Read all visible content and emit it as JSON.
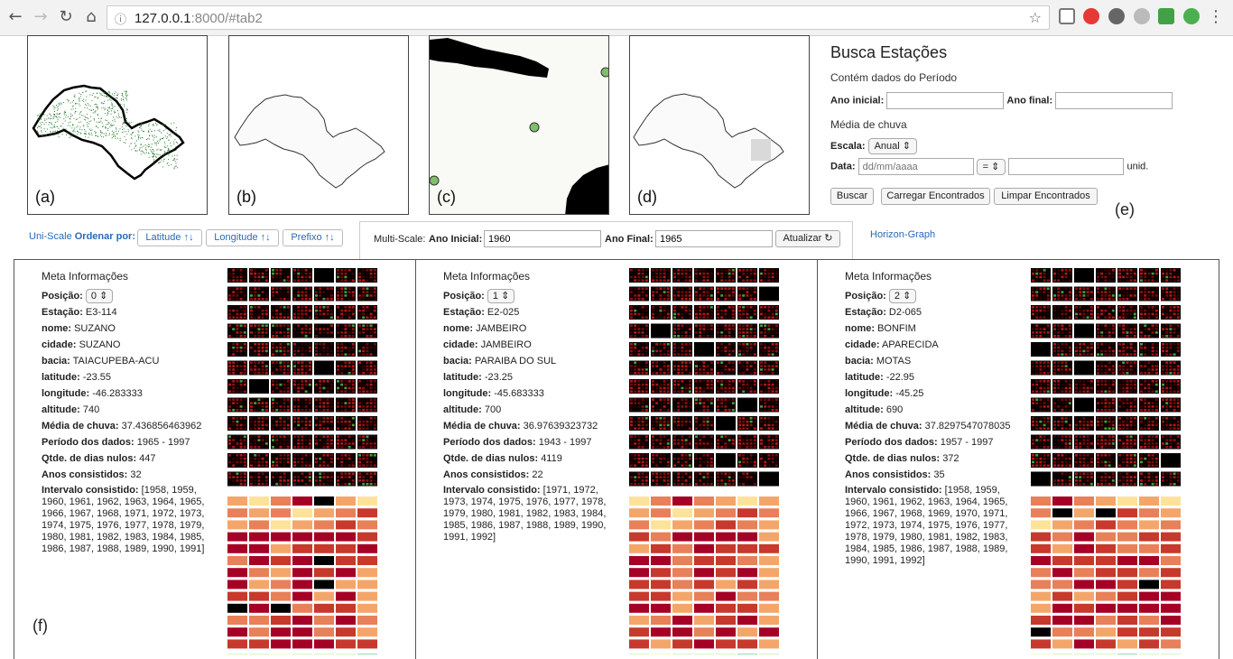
{
  "browser": {
    "url_host": "127.0.0.1",
    "url_rest": ":8000/#tab2"
  },
  "maps": [
    {
      "label": "(a)"
    },
    {
      "label": "(b)"
    },
    {
      "label": "(c)"
    },
    {
      "label": "(d)"
    }
  ],
  "busca": {
    "title": "Busca Estações",
    "periodo_label": "Contém dados do Período",
    "ano_inicial_label": "Ano inicial:",
    "ano_final_label": "Ano final:",
    "media_label": "Média de chuva",
    "escala_label": "Escala:",
    "escala_value": "Anual",
    "data_label": "Data:",
    "data_placeholder": "dd/mm/aaaa",
    "op_value": "=",
    "unid_label": "unid.",
    "buscar": "Buscar",
    "carregar": "Carregar Encontrados",
    "limpar": "Limpar Encontrados",
    "label_e": "(e)"
  },
  "toolbar": {
    "uniscale": "Uni-Scale",
    "ordenar": "Ordenar por:",
    "latitude": "Latitude ↑↓",
    "longitude": "Longitude ↑↓",
    "prefixo": "Prefixo ↑↓",
    "multiscale": "Multi-Scale:",
    "ano_inicial_label": "Ano Inicial:",
    "ano_inicial_value": "1960",
    "ano_final_label": "Ano Final:",
    "ano_final_value": "1965",
    "atualizar": "Atualizar ↻",
    "horizon": "Horizon-Graph"
  },
  "panels": [
    {
      "title": "Meta Informações",
      "posicao_label": "Posição:",
      "posicao": "0",
      "estacao_label": "Estação:",
      "estacao": "E3-114",
      "nome_label": "nome:",
      "nome": "SUZANO",
      "cidade_label": "cidade:",
      "cidade": "SUZANO",
      "bacia_label": "bacia:",
      "bacia": "TAIACUPEBA-ACU",
      "latitude_label": "latitude:",
      "latitude": "-23.55",
      "longitude_label": "longitude:",
      "longitude": "-46.283333",
      "altitude_label": "altitude:",
      "altitude": "740",
      "media_label": "Média de chuva:",
      "media": "37.436856463962",
      "periodo_label": "Período dos dados:",
      "periodo": "1965 - 1997",
      "nulos_label": "Qtde. de dias nulos:",
      "nulos": "447",
      "anos_label": "Anos consistidos:",
      "anos": "32",
      "intervalo_label": "Intervalo consistido:",
      "intervalo": "[1958, 1959, 1960, 1961, 1962, 1963, 1964, 1965, 1966, 1967, 1968, 1971, 1972, 1973, 1974, 1975, 1976, 1977, 1978, 1979, 1980, 1981, 1982, 1983, 1984, 1985, 1986, 1987, 1988, 1989, 1990, 1991]",
      "flabel": "(f)"
    },
    {
      "title": "Meta Informações",
      "posicao_label": "Posição:",
      "posicao": "1",
      "estacao_label": "Estação:",
      "estacao": "E2-025",
      "nome_label": "nome:",
      "nome": "JAMBEIRO",
      "cidade_label": "cidade:",
      "cidade": "JAMBEIRO",
      "bacia_label": "bacia:",
      "bacia": "PARAIBA DO SUL",
      "latitude_label": "latitude:",
      "latitude": "-23.25",
      "longitude_label": "longitude:",
      "longitude": "-45.683333",
      "altitude_label": "altitude:",
      "altitude": "700",
      "media_label": "Média de chuva:",
      "media": "36.97639323732",
      "periodo_label": "Período dos dados:",
      "periodo": "1943 - 1997",
      "nulos_label": "Qtde. de dias nulos:",
      "nulos": "4119",
      "anos_label": "Anos consistidos:",
      "anos": "22",
      "intervalo_label": "Intervalo consistido:",
      "intervalo": "[1971, 1972, 1973, 1974, 1975, 1976, 1977, 1978, 1979, 1980, 1981, 1982, 1983, 1984, 1985, 1986, 1987, 1988, 1989, 1990, 1991, 1992]",
      "flabel": ""
    },
    {
      "title": "Meta Informações",
      "posicao_label": "Posição:",
      "posicao": "2",
      "estacao_label": "Estação:",
      "estacao": "D2-065",
      "nome_label": "nome:",
      "nome": "BONFIM",
      "cidade_label": "cidade:",
      "cidade": "APARECIDA",
      "bacia_label": "bacia:",
      "bacia": "MOTAS",
      "latitude_label": "latitude:",
      "latitude": "-22.95",
      "longitude_label": "longitude:",
      "longitude": "-45.25",
      "altitude_label": "altitude:",
      "altitude": "690",
      "media_label": "Média de chuva:",
      "media": "37.8297547078035",
      "periodo_label": "Período dos dados:",
      "periodo": "1957 - 1997",
      "nulos_label": "Qtde. de dias nulos:",
      "nulos": "372",
      "anos_label": "Anos consistidos:",
      "anos": "35",
      "intervalo_label": "Intervalo consistido:",
      "intervalo": "[1958, 1959, 1960, 1961, 1962, 1963, 1964, 1965, 1966, 1967, 1968, 1969, 1970, 1971, 1972, 1973, 1974, 1975, 1976, 1977, 1978, 1979, 1980, 1981, 1982, 1983, 1984, 1985, 1986, 1987, 1988, 1989, 1990, 1991, 1992]",
      "flabel": ""
    }
  ],
  "colors": {
    "dark_red": "#a50026",
    "red": "#c7392d",
    "orange": "#e8805a",
    "light_orange": "#f4a66a",
    "pale": "#fde39a",
    "light_green": "#a6d96a",
    "green": "#1a9850",
    "black": "#000000",
    "map_dot": "#2e7d32"
  }
}
